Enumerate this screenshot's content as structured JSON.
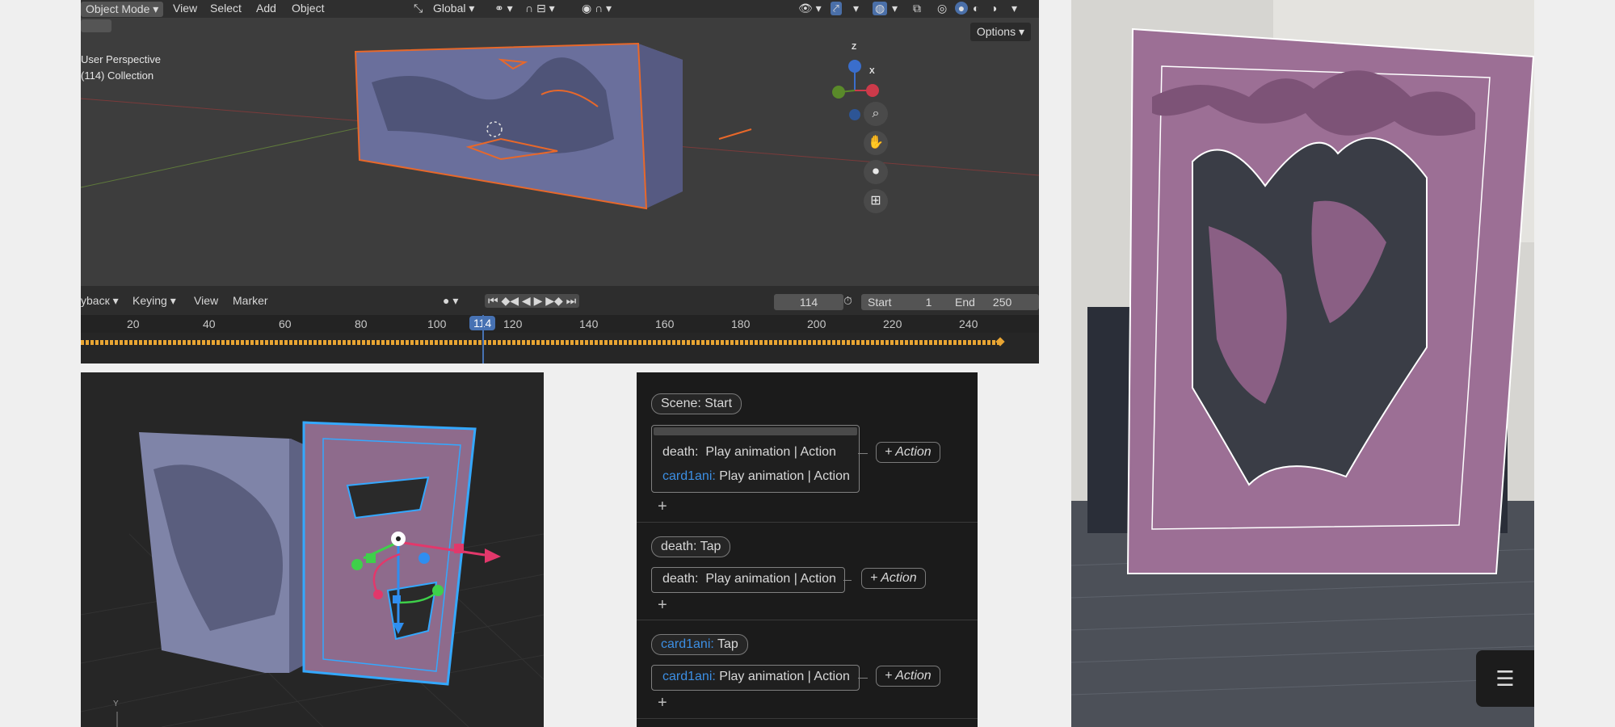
{
  "blender": {
    "header": {
      "mode": "Object Mode",
      "menu": [
        "View",
        "Select",
        "Add",
        "Object"
      ],
      "orientation": "Global"
    },
    "viewport": {
      "perspective": "User Perspective",
      "collection": "(114) Collection",
      "options": "Options",
      "gizmo": {
        "z": "Z",
        "x": "X"
      }
    },
    "timeline": {
      "menu": [
        "ybacк",
        "Keying",
        "View",
        "Marker"
      ],
      "current_frame": "114",
      "start_label": "Start",
      "start_value": "1",
      "end_label": "End",
      "end_value": "250",
      "ticks": [
        "20",
        "40",
        "60",
        "80",
        "100",
        "120",
        "140",
        "160",
        "180",
        "200",
        "220",
        "240"
      ],
      "playhead": "114"
    }
  },
  "rc3d": {
    "axis_label": "Y"
  },
  "behaviors": {
    "blocks": [
      {
        "trigger_object": "",
        "trigger": "Scene:  Start",
        "actions": [
          {
            "object": "death:",
            "text": "Play animation | Action"
          },
          {
            "object": "card1ani:",
            "text": "Play animation | Action",
            "blue": true
          }
        ],
        "add_action": "+ Action"
      },
      {
        "trigger_object": "death:",
        "trigger": "Tap",
        "actions": [
          {
            "object": "death:",
            "text": "Play animation | Action"
          }
        ],
        "add_action": "+ Action"
      },
      {
        "trigger_object": "card1ani:",
        "trigger": "Tap",
        "actions": [
          {
            "object": "card1ani:",
            "text": "Play animation | Action",
            "blue": true
          }
        ],
        "add_action": "+ Action"
      }
    ],
    "plus": "+"
  },
  "ar": {
    "list_icon": "list-icon"
  }
}
